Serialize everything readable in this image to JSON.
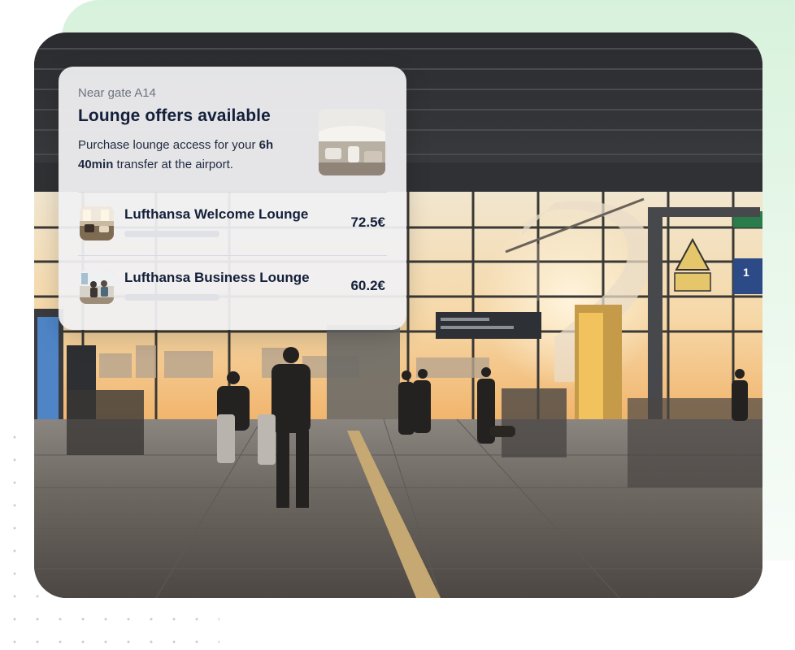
{
  "card": {
    "location": "Near gate A14",
    "title": "Lounge offers available",
    "description_prefix": "Purchase lounge access for your ",
    "transfer_time": "6h 40min",
    "description_suffix": " transfer at the airport."
  },
  "lounges": [
    {
      "name": "Lufthansa Welcome Lounge",
      "price": "72.5€"
    },
    {
      "name": "Lufthansa Business Lounge",
      "price": "60.2€"
    }
  ],
  "photo": {
    "sign_text": "1"
  },
  "colors": {
    "text_primary": "#14203a",
    "text_secondary": "#6d7380",
    "background_accent": "#d7f2dc"
  }
}
